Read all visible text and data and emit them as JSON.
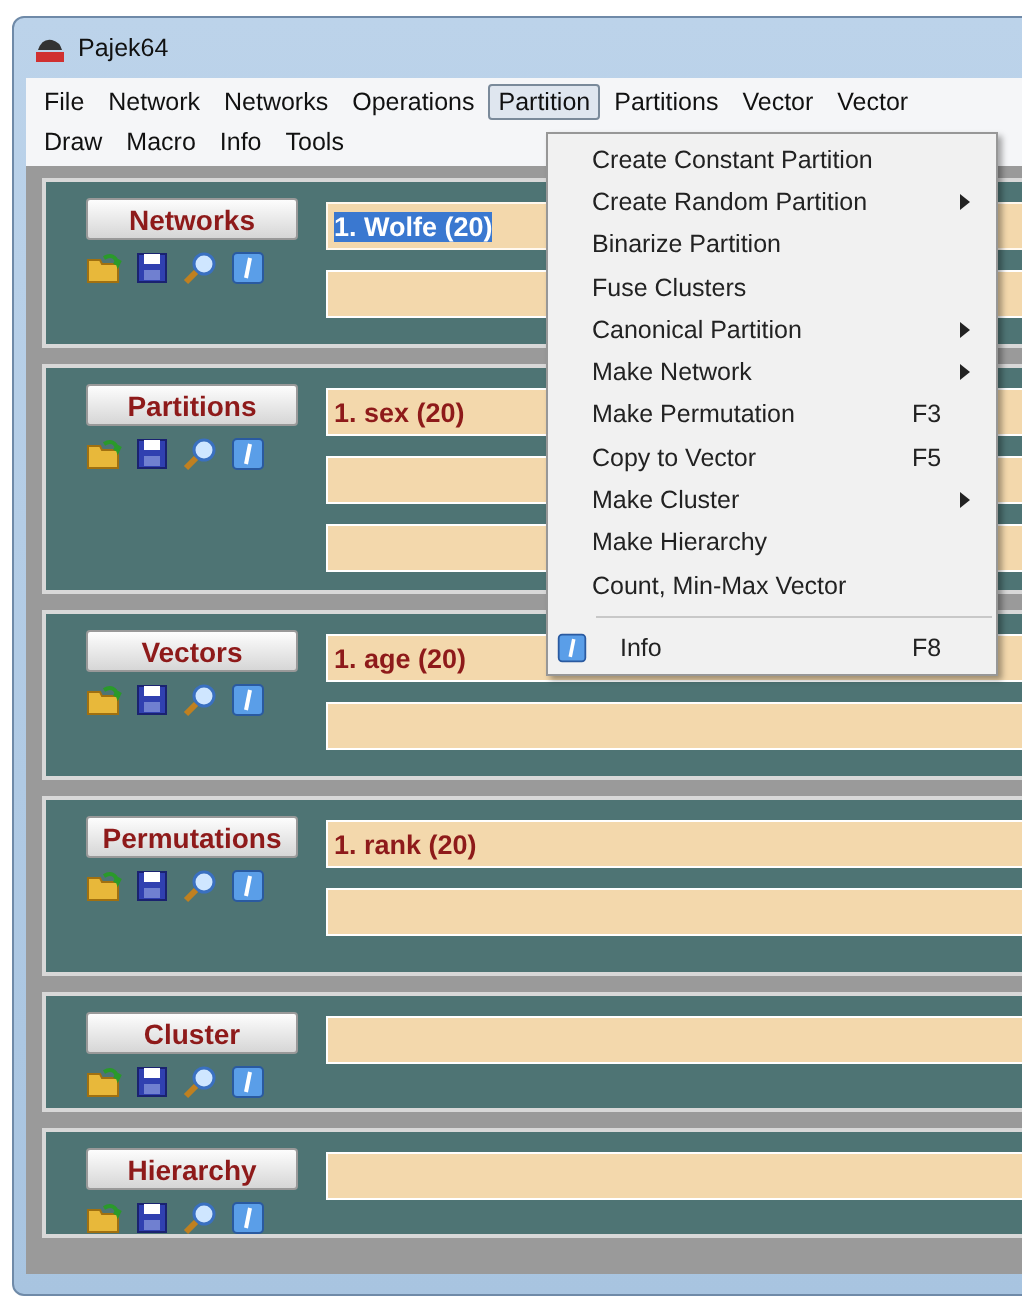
{
  "window": {
    "title": "Pajek64"
  },
  "menu_rows": [
    [
      {
        "label": "File",
        "selected": false
      },
      {
        "label": "Network",
        "selected": false
      },
      {
        "label": "Networks",
        "selected": false
      },
      {
        "label": "Operations",
        "selected": false
      },
      {
        "label": "Partition",
        "selected": true
      },
      {
        "label": "Partitions",
        "selected": false
      },
      {
        "label": "Vector",
        "selected": false
      },
      {
        "label": "Vector",
        "selected": false
      }
    ],
    [
      {
        "label": "Draw",
        "selected": false
      },
      {
        "label": "Macro",
        "selected": false
      },
      {
        "label": "Info",
        "selected": false
      },
      {
        "label": "Tools",
        "selected": false
      }
    ]
  ],
  "panels": [
    {
      "button": "Networks",
      "fields": [
        {
          "text": "1. Wolfe (20)",
          "selected": true
        },
        {
          "selected": false
        }
      ]
    },
    {
      "button": "Partitions",
      "fields": [
        {
          "text": "1. sex (20)",
          "selected": false
        },
        {
          "selected": false
        },
        {
          "selected": false
        }
      ]
    },
    {
      "button": "Vectors",
      "fields": [
        {
          "text": "1. age (20)",
          "selected": false
        },
        {
          "selected": false
        }
      ]
    },
    {
      "button": "Permutations",
      "fields": [
        {
          "text": "1. rank (20)",
          "selected": false
        },
        {
          "selected": false
        }
      ]
    },
    {
      "button": "Cluster",
      "fields": [
        {
          "selected": false
        }
      ]
    },
    {
      "button": "Hierarchy",
      "fields": [
        {
          "selected": false
        }
      ]
    }
  ],
  "dropdown": [
    {
      "kind": "item",
      "label": "Create Constant Partition"
    },
    {
      "kind": "submenu",
      "label": "Create Random Partition"
    },
    {
      "kind": "item",
      "label": "Binarize Partition"
    },
    {
      "kind": "item",
      "label": "Fuse Clusters"
    },
    {
      "kind": "submenu",
      "label": "Canonical Partition"
    },
    {
      "kind": "submenu",
      "label": "Make Network"
    },
    {
      "kind": "item",
      "label": "Make Permutation",
      "shortcut": "F3"
    },
    {
      "kind": "item",
      "label": "Copy to Vector",
      "shortcut": "F5"
    },
    {
      "kind": "submenu",
      "label": "Make Cluster"
    },
    {
      "kind": "item",
      "label": "Make Hierarchy"
    },
    {
      "kind": "item",
      "label": "Count, Min-Max Vector"
    },
    {
      "kind": "separator"
    },
    {
      "kind": "icon-item",
      "label": "Info",
      "shortcut": "F8"
    }
  ]
}
